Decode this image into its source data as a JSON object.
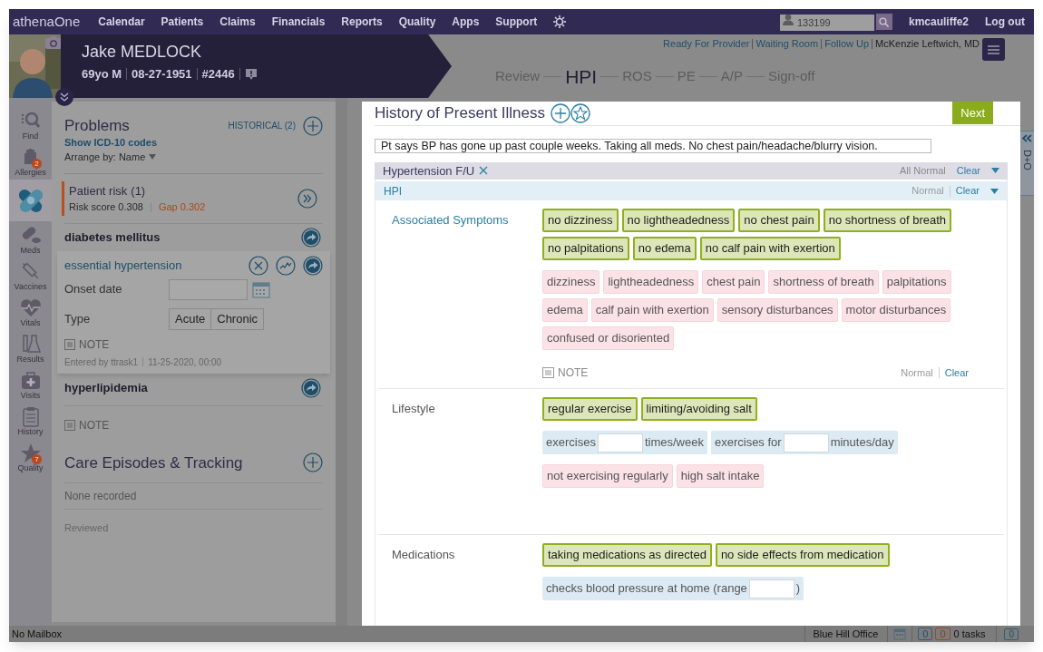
{
  "nav": {
    "logo": "athenaOne",
    "items": [
      "Calendar",
      "Patients",
      "Claims",
      "Financials",
      "Reports",
      "Quality",
      "Apps",
      "Support"
    ],
    "search": {
      "value": "133199"
    },
    "user": "kmcauliffe2",
    "logout": "Log out"
  },
  "patient": {
    "name": "Jake MEDLOCK",
    "age_sex": "69yo M",
    "dob": "08-27-1951",
    "id": "#2446"
  },
  "status_links": [
    "Ready For Provider",
    "Waiting Room",
    "Follow Up"
  ],
  "provider": "McKenzie Leftwich, MD",
  "stages": [
    {
      "label": "Review",
      "selected": false
    },
    {
      "label": "HPI",
      "selected": true
    },
    {
      "label": "ROS",
      "selected": false
    },
    {
      "label": "PE",
      "selected": false
    },
    {
      "label": "A/P",
      "selected": false
    },
    {
      "label": "Sign-off",
      "selected": false
    }
  ],
  "rail": [
    {
      "label": "Find",
      "selected": false
    },
    {
      "label": "Allergies",
      "badge": "2",
      "selected": false
    },
    {
      "selected": true
    },
    {
      "label": "Meds",
      "selected": false
    },
    {
      "label": "Vaccines",
      "selected": false
    },
    {
      "label": "Vitals",
      "selected": false
    },
    {
      "label": "Results",
      "selected": false
    },
    {
      "label": "Visits",
      "selected": false
    },
    {
      "label": "History",
      "selected": false
    },
    {
      "label": "Quality",
      "badge": "7",
      "selected": false
    }
  ],
  "problems": {
    "title": "Problems",
    "historical": "HISTORICAL (2)",
    "icd_link": "Show ICD-10 codes",
    "arrange": "Arrange by: Name",
    "risk": {
      "title": "Patient risk",
      "count": "(1)",
      "score_label": "Risk score",
      "score": "0.308",
      "gap": "Gap 0.302"
    },
    "items": [
      {
        "name": "diabetes mellitus",
        "expanded": false
      },
      {
        "name": "essential hypertension",
        "expanded": true,
        "onset_label": "Onset date",
        "type_label": "Type",
        "types": [
          {
            "label": "Acute",
            "selected": false
          },
          {
            "label": "Chronic",
            "selected": false
          }
        ],
        "note": "NOTE",
        "entered_by": "Entered by ttrask1",
        "entered_at": "11-25-2020, 00:00"
      },
      {
        "name": "hyperlipidemia",
        "expanded": false
      }
    ],
    "note": "NOTE"
  },
  "care": {
    "title": "Care Episodes & Tracking",
    "empty": "None recorded",
    "reviewed": "Reviewed"
  },
  "hpi": {
    "title": "History of Present Illness",
    "next": "Next",
    "narrative": "Pt says BP has gone up past couple weeks. Taking all meds. No chest pain/headache/blurry vision.",
    "template": {
      "name": "Hypertension F/U",
      "all_normal": "All Normal",
      "clear": "Clear"
    },
    "section": {
      "name": "HPI",
      "normal": "Normal",
      "clear": "Clear"
    },
    "groups": [
      {
        "label": "Associated Symptoms",
        "linked": true,
        "sets": [
          {
            "chips": [
              {
                "kind": "option",
                "label": "no dizziness",
                "selected": true
              },
              {
                "kind": "option",
                "label": "no lightheadedness",
                "selected": true
              },
              {
                "kind": "option",
                "label": "no chest pain",
                "selected": true
              },
              {
                "kind": "option",
                "label": "no shortness of breath",
                "selected": true
              },
              {
                "kind": "option",
                "label": "no palpitations",
                "selected": true
              },
              {
                "kind": "option",
                "label": "no edema",
                "selected": true
              },
              {
                "kind": "option",
                "label": "no calf pain with exertion",
                "selected": true
              }
            ]
          },
          {
            "chips": [
              {
                "kind": "option",
                "label": "dizziness",
                "selected": false
              },
              {
                "kind": "option",
                "label": "lightheadedness",
                "selected": false
              },
              {
                "kind": "option",
                "label": "chest pain",
                "selected": false
              },
              {
                "kind": "option",
                "label": "shortness of breath",
                "selected": false
              },
              {
                "kind": "option",
                "label": "palpitations",
                "selected": false
              },
              {
                "kind": "option",
                "label": "edema",
                "selected": false
              },
              {
                "kind": "option",
                "label": "calf pain with exertion",
                "selected": false
              },
              {
                "kind": "option",
                "label": "sensory disturbances",
                "selected": false
              },
              {
                "kind": "option",
                "label": "motor disturbances",
                "selected": false
              },
              {
                "kind": "option",
                "label": "confused or disoriented",
                "selected": false
              }
            ]
          }
        ],
        "note": {
          "label": "NOTE",
          "normal": "Normal",
          "clear": "Clear"
        }
      },
      {
        "label": "Lifestyle",
        "linked": false,
        "sets": [
          {
            "chips": [
              {
                "kind": "option",
                "label": "regular exercise",
                "selected": true
              },
              {
                "kind": "option",
                "label": "limiting/avoiding salt",
                "selected": true
              }
            ]
          },
          {
            "chips": [
              {
                "kind": "input",
                "before": "exercises",
                "after": "times/week"
              },
              {
                "kind": "input",
                "before": "exercises for",
                "after": "minutes/day"
              }
            ]
          },
          {
            "chips": [
              {
                "kind": "option",
                "label": "not exercising regularly",
                "selected": false
              },
              {
                "kind": "option",
                "label": "high salt intake",
                "selected": false
              }
            ]
          }
        ]
      },
      {
        "label": "Medications",
        "linked": false,
        "sets": [
          {
            "chips": [
              {
                "kind": "option",
                "label": "taking medications as directed",
                "selected": true
              },
              {
                "kind": "option",
                "label": "no side effects from medication",
                "selected": true
              }
            ]
          },
          {
            "chips": [
              {
                "kind": "input",
                "before": "checks blood pressure at home (range",
                "after": ")"
              }
            ]
          }
        ]
      }
    ]
  },
  "side_tab": "D+O",
  "status_bar": {
    "mailbox": "No Mailbox",
    "office": "Blue Hill Office",
    "count_a": "0",
    "count_b": "0",
    "tasks": "0 tasks",
    "messages": "0"
  }
}
